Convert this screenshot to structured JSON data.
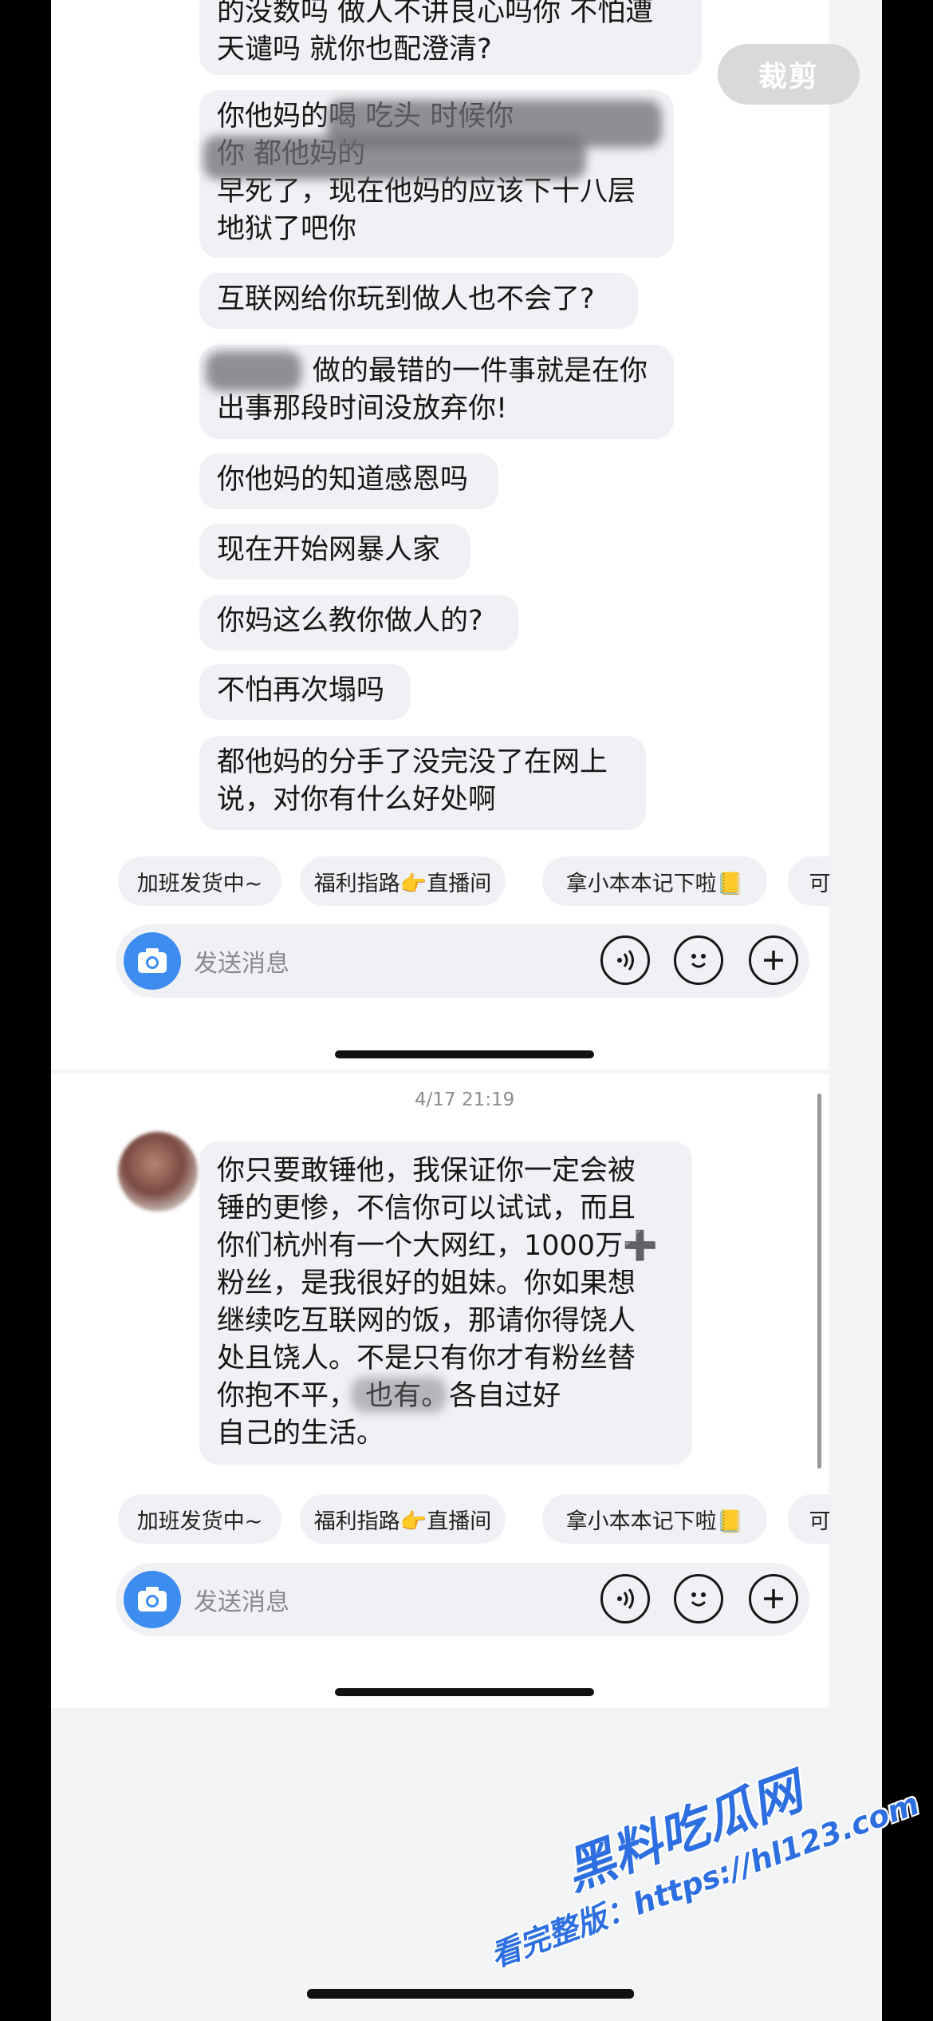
{
  "crop_button": {
    "label": "裁剪"
  },
  "chat1": {
    "messages": [
      {
        "lines": [
          "的没数吗 做人不讲良心吗你 不怕遭",
          "天谴吗 就你也配澄清?"
        ]
      },
      {
        "lines": [
          "你他妈的喝 吃头 时候你",
          "你 都他妈的",
          "早死了，现在他妈的应该下十八层",
          "地狱了吧你"
        ]
      },
      {
        "lines": [
          "互联网给你玩到做人也不会了?"
        ]
      },
      {
        "lines": [
          "做的最错的一件事就是在你",
          "出事那段时间没放弃你!"
        ]
      },
      {
        "lines": [
          "你他妈的知道感恩吗"
        ]
      },
      {
        "lines": [
          "现在开始网暴人家"
        ]
      },
      {
        "lines": [
          "你妈这么教你做人的?"
        ]
      },
      {
        "lines": [
          "不怕再次塌吗"
        ]
      },
      {
        "lines": [
          "都他妈的分手了没完没了在网上",
          "说，对你有什么好处啊"
        ]
      }
    ],
    "quick_replies": [
      "加班发货中~",
      "福利指路👉直播间",
      "拿小本本记下啦📒",
      "可"
    ],
    "input_placeholder": "发送消息"
  },
  "chat2": {
    "timestamp": "4/17 21:19",
    "message_lines": [
      "你只要敢锤他，我保证你一定会被",
      "锤的更惨，不信你可以试试，而且",
      "你们杭州有一个大网红，1000万➕",
      "粉丝，是我很好的姐妹。你如果想",
      "继续吃互联网的饭，那请你得饶人",
      "处且饶人。不是只有你才有粉丝替",
      "你抱不平，    也有。各自过好",
      "自己的生活。"
    ],
    "quick_replies": [
      "加班发货中~",
      "福利指路👉直播间",
      "拿小本本记下啦📒",
      "可"
    ],
    "input_placeholder": "发送消息"
  },
  "watermark": {
    "line1": "黑料吃瓜网",
    "line2": "看完整版：https://hl123.com"
  },
  "icons": [
    "camera-icon",
    "voice-icon",
    "emoji-icon",
    "plus-icon",
    "avatar"
  ],
  "colors": {
    "accent": "#3d8cf0",
    "bubble": "#f0f1f4",
    "watermark": "#2d6fe0"
  }
}
